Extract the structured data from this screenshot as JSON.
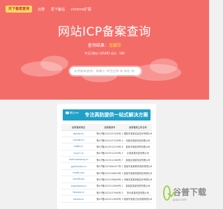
{
  "nav": {
    "logo": "天下备案查询",
    "links": [
      "云搜",
      "爱下备站",
      "chrome扩展"
    ]
  },
  "hero": {
    "title": "网站ICP备案查询",
    "status_label": "查询结果：",
    "status_value": "无缓存",
    "stat_line": "今日已统计 185485 总计：180"
  },
  "search": {
    "placeholder": "支持备案查询，如输入 单位全称 或 域名 或"
  },
  "banner": {
    "brand": "魔云cdn",
    "text": "专注高防提供一站式解决方案"
  },
  "table": {
    "headers": [
      "最新备案网站",
      "最新备案号",
      "最新备案主体名称"
    ],
    "rows": [
      [
        "ebisiia.cn",
        "豫ICP备2022437428号-2",
        "濮阳市某某信息技术有限公司"
      ],
      [
        "cyzvdp.cn",
        "豫ICP备2022437528号-4",
        "河南省某某科技有限公司"
      ],
      [
        "byq8.cn",
        "豫ICP备2023012216号-6",
        "某某市某某商贸有限公司"
      ],
      [
        "hcyo7.cn",
        "豫ICP备2023012329号-3",
        "元宵某某科技有限公司"
      ],
      [
        "zhenhuamang.cn",
        "豫ICP备2023012266号-7",
        "某某区某某科技有限公司"
      ],
      [
        "gyylcjcedu.cn",
        "豫ICP备2023064437号-1",
        "某某市某某教育咨询有限公司"
      ],
      [
        "trydb.com",
        "豫ICP备2022038826号-3",
        "某某市某某网络科技有限公司"
      ],
      [
        "zvkxdf.pro",
        "豫ICP备2022038898号-2",
        "河南省某某网络技术有限公司"
      ],
      [
        "ciyanwanq.cn",
        "豫ICP备2022012898号-1",
        "某某县某某商贸有限公司"
      ],
      [
        "hkxxxq.cn",
        "豫ICP备2022037998号-3",
        "郑州某某科技有限公司"
      ],
      [
        "vtsmia.cn",
        "豫ICP备2022012898号-3",
        "某某市某某文化传媒有限公司"
      ]
    ]
  },
  "app_badge": {
    "name": "谷普下载",
    "domain": "gupu.com"
  },
  "colors": {
    "hero": "#f46c68",
    "banner": "#21a0c8",
    "link": "#2f7fc7",
    "badge": "#9ed04a"
  }
}
